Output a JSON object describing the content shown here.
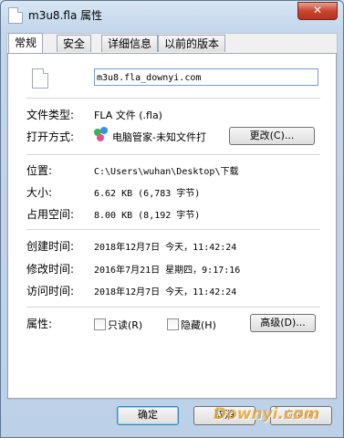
{
  "window": {
    "title": "m3u8.fla 属性",
    "close_label": "✕"
  },
  "tabs": [
    {
      "label": "常规",
      "active": true
    },
    {
      "label": "安全"
    },
    {
      "label": "详细信息"
    },
    {
      "label": "以前的版本"
    }
  ],
  "general": {
    "file_name": "m3u8.fla_downyi.com",
    "type_label": "文件类型:",
    "type_value": "FLA 文件 (.fla)",
    "open_with_label": "打开方式:",
    "open_with_value": "电脑管家-未知文件打",
    "change_button": "更改(C)...",
    "location_label": "位置:",
    "location_value": "C:\\Users\\wuhan\\Desktop\\下载",
    "size_label": "大小:",
    "size_value": "6.62 KB (6,783 字节)",
    "disk_size_label": "占用空间:",
    "disk_size_value": "8.00 KB (8,192 字节)",
    "created_label": "创建时间:",
    "created_value": "2018年12月7日 今天，11:42:24",
    "modified_label": "修改时间:",
    "modified_value": "2016年7月21日 星期四，9:17:16",
    "accessed_label": "访问时间:",
    "accessed_value": "2018年12月7日 今天，11:42:24",
    "attributes_label": "属性:",
    "readonly_label": "只读(R)",
    "hidden_label": "隐藏(H)",
    "advanced_button": "高级(D)..."
  },
  "footer": {
    "ok_button": "确定",
    "cancel_button": "取消",
    "apply_button": "应用(A)"
  },
  "watermark": "Downyi.com"
}
